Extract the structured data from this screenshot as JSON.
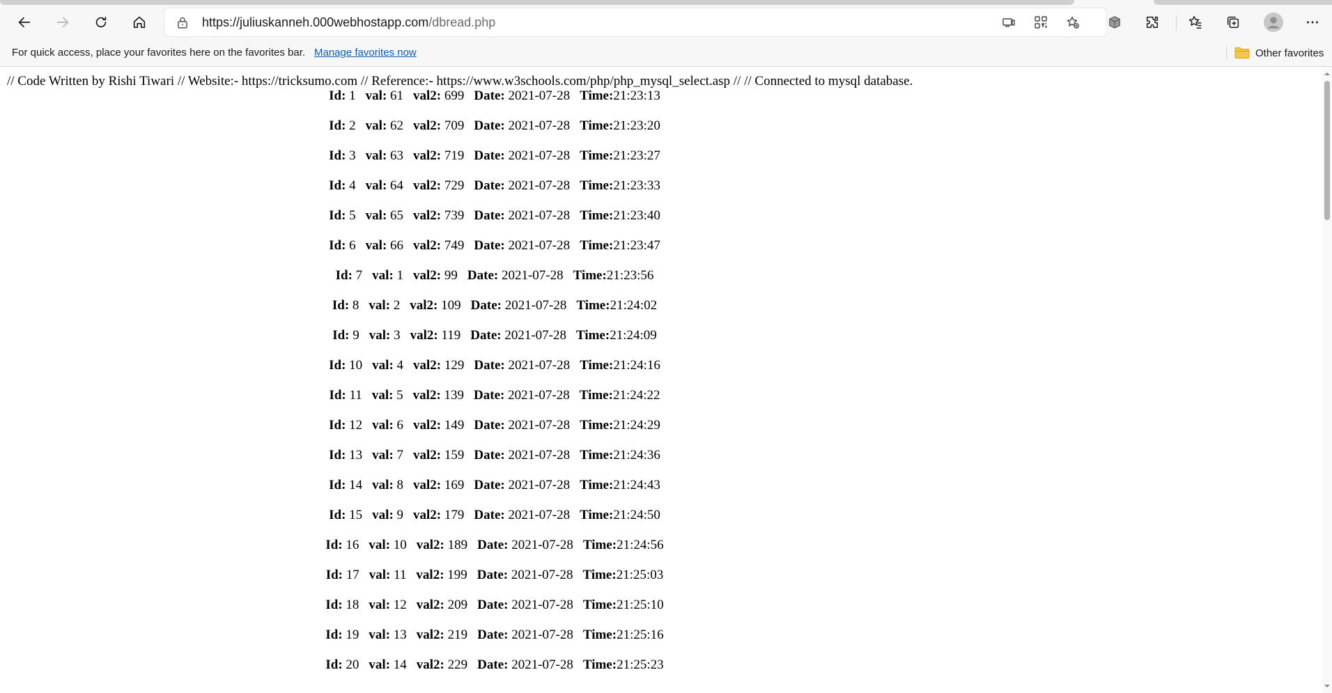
{
  "browser": {
    "url_host": "https://juliuskanneh.000webhostapp.com",
    "url_path": "/dbread.php",
    "favorites_bar": {
      "message": "For quick access, place your favorites here on the favorites bar.",
      "manage_link": "Manage favorites now",
      "other_favorites": "Other favorites"
    },
    "icons": {
      "back": "back-arrow-icon",
      "forward": "forward-arrow-icon",
      "refresh": "refresh-icon",
      "home": "home-icon",
      "lock": "lock-icon",
      "app_available": "app-available-icon",
      "qr": "qr-code-icon",
      "add_favorite": "star-add-icon",
      "extension_cube": "cube-icon",
      "extensions": "puzzle-icon",
      "favorites": "favorites-list-icon",
      "collections": "collections-icon",
      "profile": "profile-avatar-icon",
      "menu": "more-menu-icon",
      "folder": "folder-icon"
    }
  },
  "page": {
    "header_text": "// Code Written by Rishi Tiwari // Website:- https://tricksumo.com // Reference:- https://www.w3schools.com/php/php_mysql_select.asp // // Connected to mysql database.",
    "labels": {
      "id": "Id:",
      "val": "val:",
      "val2": "val2:",
      "date": "Date:",
      "time": "Time:"
    },
    "rows": [
      {
        "id": "1",
        "val": "61",
        "val2": "699",
        "date": "2021-07-28",
        "time": "21:23:13"
      },
      {
        "id": "2",
        "val": "62",
        "val2": "709",
        "date": "2021-07-28",
        "time": "21:23:20"
      },
      {
        "id": "3",
        "val": "63",
        "val2": "719",
        "date": "2021-07-28",
        "time": "21:23:27"
      },
      {
        "id": "4",
        "val": "64",
        "val2": "729",
        "date": "2021-07-28",
        "time": "21:23:33"
      },
      {
        "id": "5",
        "val": "65",
        "val2": "739",
        "date": "2021-07-28",
        "time": "21:23:40"
      },
      {
        "id": "6",
        "val": "66",
        "val2": "749",
        "date": "2021-07-28",
        "time": "21:23:47"
      },
      {
        "id": "7",
        "val": "1",
        "val2": "99",
        "date": "2021-07-28",
        "time": "21:23:56"
      },
      {
        "id": "8",
        "val": "2",
        "val2": "109",
        "date": "2021-07-28",
        "time": "21:24:02"
      },
      {
        "id": "9",
        "val": "3",
        "val2": "119",
        "date": "2021-07-28",
        "time": "21:24:09"
      },
      {
        "id": "10",
        "val": "4",
        "val2": "129",
        "date": "2021-07-28",
        "time": "21:24:16"
      },
      {
        "id": "11",
        "val": "5",
        "val2": "139",
        "date": "2021-07-28",
        "time": "21:24:22"
      },
      {
        "id": "12",
        "val": "6",
        "val2": "149",
        "date": "2021-07-28",
        "time": "21:24:29"
      },
      {
        "id": "13",
        "val": "7",
        "val2": "159",
        "date": "2021-07-28",
        "time": "21:24:36"
      },
      {
        "id": "14",
        "val": "8",
        "val2": "169",
        "date": "2021-07-28",
        "time": "21:24:43"
      },
      {
        "id": "15",
        "val": "9",
        "val2": "179",
        "date": "2021-07-28",
        "time": "21:24:50"
      },
      {
        "id": "16",
        "val": "10",
        "val2": "189",
        "date": "2021-07-28",
        "time": "21:24:56"
      },
      {
        "id": "17",
        "val": "11",
        "val2": "199",
        "date": "2021-07-28",
        "time": "21:25:03"
      },
      {
        "id": "18",
        "val": "12",
        "val2": "209",
        "date": "2021-07-28",
        "time": "21:25:10"
      },
      {
        "id": "19",
        "val": "13",
        "val2": "219",
        "date": "2021-07-28",
        "time": "21:25:16"
      },
      {
        "id": "20",
        "val": "14",
        "val2": "229",
        "date": "2021-07-28",
        "time": "21:25:23"
      }
    ]
  }
}
